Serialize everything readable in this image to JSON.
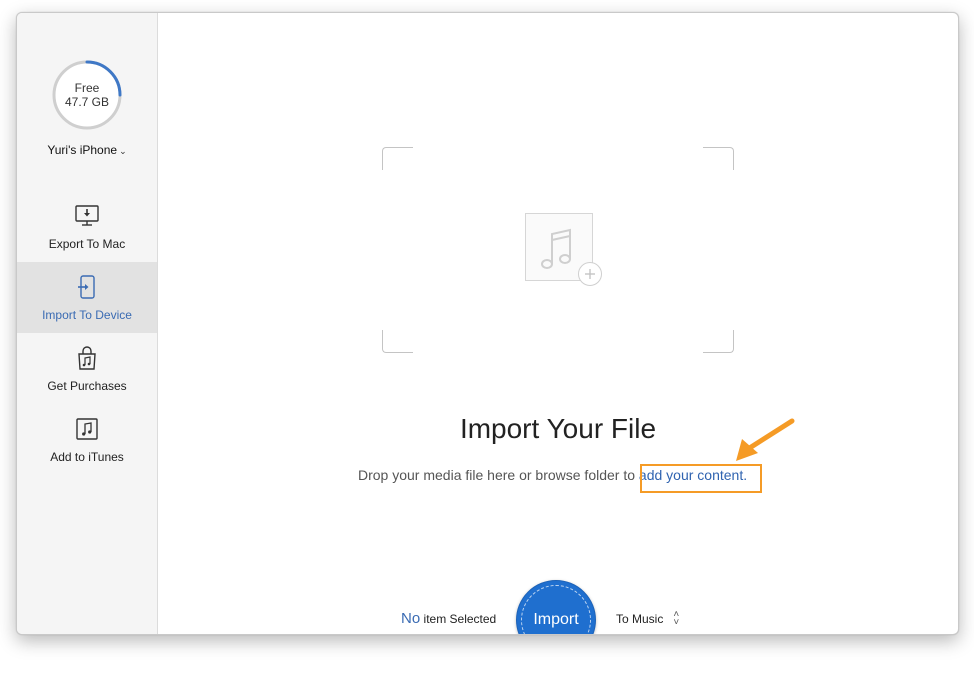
{
  "sidebar": {
    "storage": {
      "line1": "Free",
      "line2": "47.7 GB",
      "used_fraction": 0.25
    },
    "device_name": "Yuri's iPhone",
    "items": [
      {
        "label": "Export To Mac",
        "icon": "monitor-download-icon",
        "active": false
      },
      {
        "label": "Import To Device",
        "icon": "phone-import-icon",
        "active": true
      },
      {
        "label": "Get Purchases",
        "icon": "shopping-bag-music-icon",
        "active": false
      },
      {
        "label": "Add to iTunes",
        "icon": "music-note-box-icon",
        "active": false
      }
    ]
  },
  "main": {
    "title": "Import Your File",
    "drop_text": "Drop your media file here or browse folder to ",
    "drop_link": "add your content.",
    "status_no": "No",
    "status_rest": " item Selected",
    "import_button": "Import",
    "destination": "To Music"
  },
  "colors": {
    "accent": "#1f6fcf",
    "link": "#2f63b0",
    "highlight": "#f59b26",
    "active_nav_bg": "#e2e2e2"
  }
}
